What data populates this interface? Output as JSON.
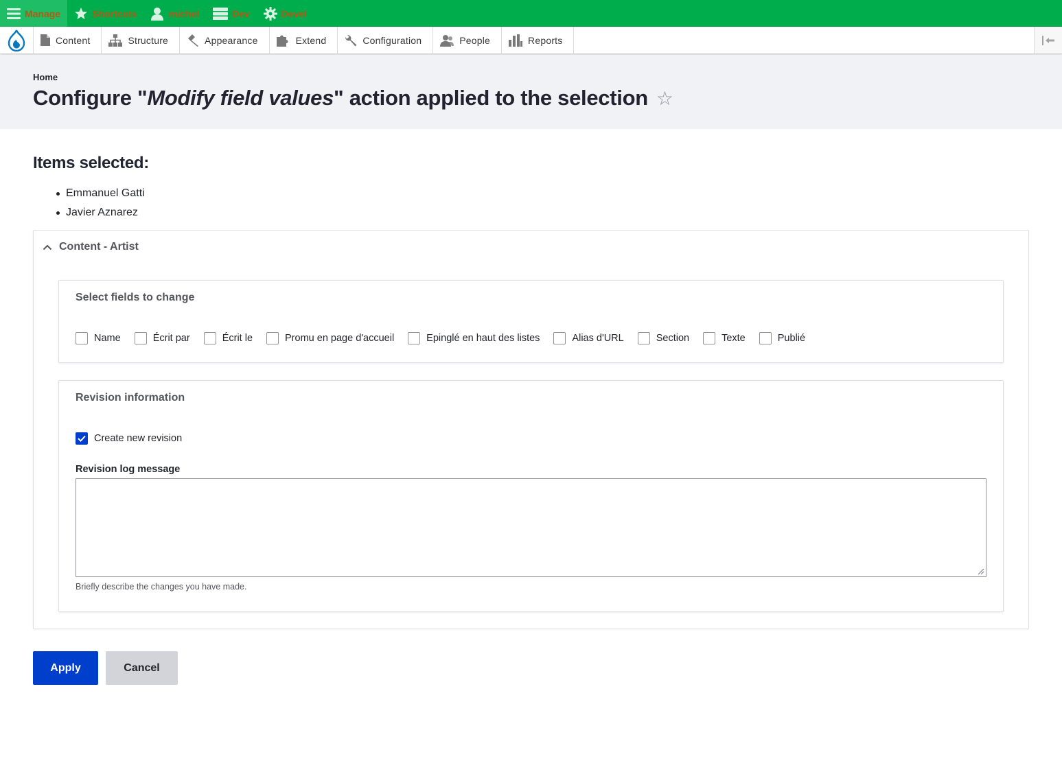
{
  "toolbar": {
    "items": [
      {
        "label": "Manage",
        "icon": "menu-icon"
      },
      {
        "label": "Shortcuts",
        "icon": "star-icon"
      },
      {
        "label": "michel",
        "icon": "user-icon"
      },
      {
        "label": "Dev",
        "icon": "server-icon"
      },
      {
        "label": "Devel",
        "icon": "gear-icon"
      }
    ]
  },
  "tray": {
    "items": [
      {
        "label": "Content",
        "icon": "file-icon"
      },
      {
        "label": "Structure",
        "icon": "sitemap-icon"
      },
      {
        "label": "Appearance",
        "icon": "paintbrush-icon"
      },
      {
        "label": "Extend",
        "icon": "puzzle-icon"
      },
      {
        "label": "Configuration",
        "icon": "wrench-icon"
      },
      {
        "label": "People",
        "icon": "people-icon"
      },
      {
        "label": "Reports",
        "icon": "bar-chart-icon"
      }
    ]
  },
  "header": {
    "breadcrumb": "Home",
    "title_prefix": "Configure \"",
    "title_action": "Modify field values",
    "title_suffix": "\" action applied to the selection",
    "star": "☆"
  },
  "items": {
    "heading": "Items selected:",
    "list": [
      "Emmanuel Gatti",
      "Javier Aznarez"
    ]
  },
  "details": {
    "summary": "Content - Artist",
    "fields": {
      "legend": "Select fields to change",
      "options": [
        {
          "label": "Name",
          "checked": false
        },
        {
          "label": "Écrit par",
          "checked": false
        },
        {
          "label": "Écrit le",
          "checked": false
        },
        {
          "label": "Promu en page d'accueil",
          "checked": false
        },
        {
          "label": "Epinglé en haut des listes",
          "checked": false
        },
        {
          "label": "Alias d'URL",
          "checked": false
        },
        {
          "label": "Section",
          "checked": false
        },
        {
          "label": "Texte",
          "checked": false
        },
        {
          "label": "Publié",
          "checked": false
        }
      ]
    },
    "revision": {
      "legend": "Revision information",
      "create_label": "Create new revision",
      "create_checked": true,
      "log_label": "Revision log message",
      "log_value": "",
      "help": "Briefly describe the changes you have made."
    }
  },
  "actions": {
    "apply": "Apply",
    "cancel": "Cancel"
  },
  "colors": {
    "toolbar_bg": "#00ad4d",
    "primary": "#003ecc",
    "header_bg": "#f1f2f5"
  }
}
